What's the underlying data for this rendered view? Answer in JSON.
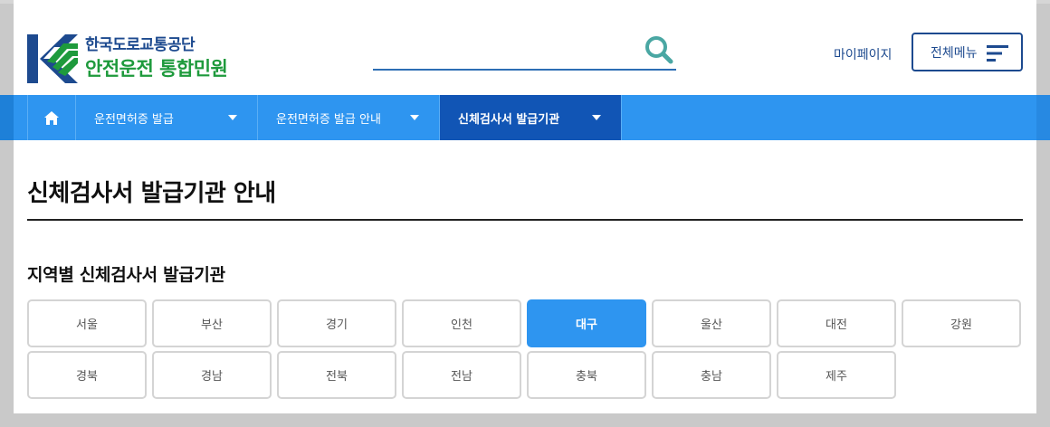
{
  "header": {
    "org_name": "한국도로교통공단",
    "site_name": "안전운전 통합민원",
    "search": {
      "placeholder": "",
      "value": ""
    },
    "mypage_label": "마이페이지",
    "menu_label": "전체메뉴"
  },
  "nav": {
    "home_icon": "home-icon",
    "items": [
      {
        "label": "운전면허증 발급",
        "active": false
      },
      {
        "label": "운전면허증 발급 안내",
        "active": false
      },
      {
        "label": "신체검사서 발급기관",
        "active": true
      }
    ]
  },
  "main": {
    "page_title": "신체검사서 발급기관 안내",
    "section_title": "지역별 신체검사서 발급기관",
    "regions": [
      {
        "label": "서울",
        "active": false
      },
      {
        "label": "부산",
        "active": false
      },
      {
        "label": "경기",
        "active": false
      },
      {
        "label": "인천",
        "active": false
      },
      {
        "label": "대구",
        "active": true
      },
      {
        "label": "울산",
        "active": false
      },
      {
        "label": "대전",
        "active": false
      },
      {
        "label": "강원",
        "active": false
      },
      {
        "label": "경북",
        "active": false
      },
      {
        "label": "경남",
        "active": false
      },
      {
        "label": "전북",
        "active": false
      },
      {
        "label": "전남",
        "active": false
      },
      {
        "label": "충북",
        "active": false
      },
      {
        "label": "충남",
        "active": false
      },
      {
        "label": "제주",
        "active": false
      }
    ]
  },
  "colors": {
    "nav_bg": "#2e95f0",
    "nav_active": "#1155b5",
    "brand_blue": "#1d4a8f",
    "brand_green": "#1e9a3c",
    "region_active": "#2e95f0"
  }
}
